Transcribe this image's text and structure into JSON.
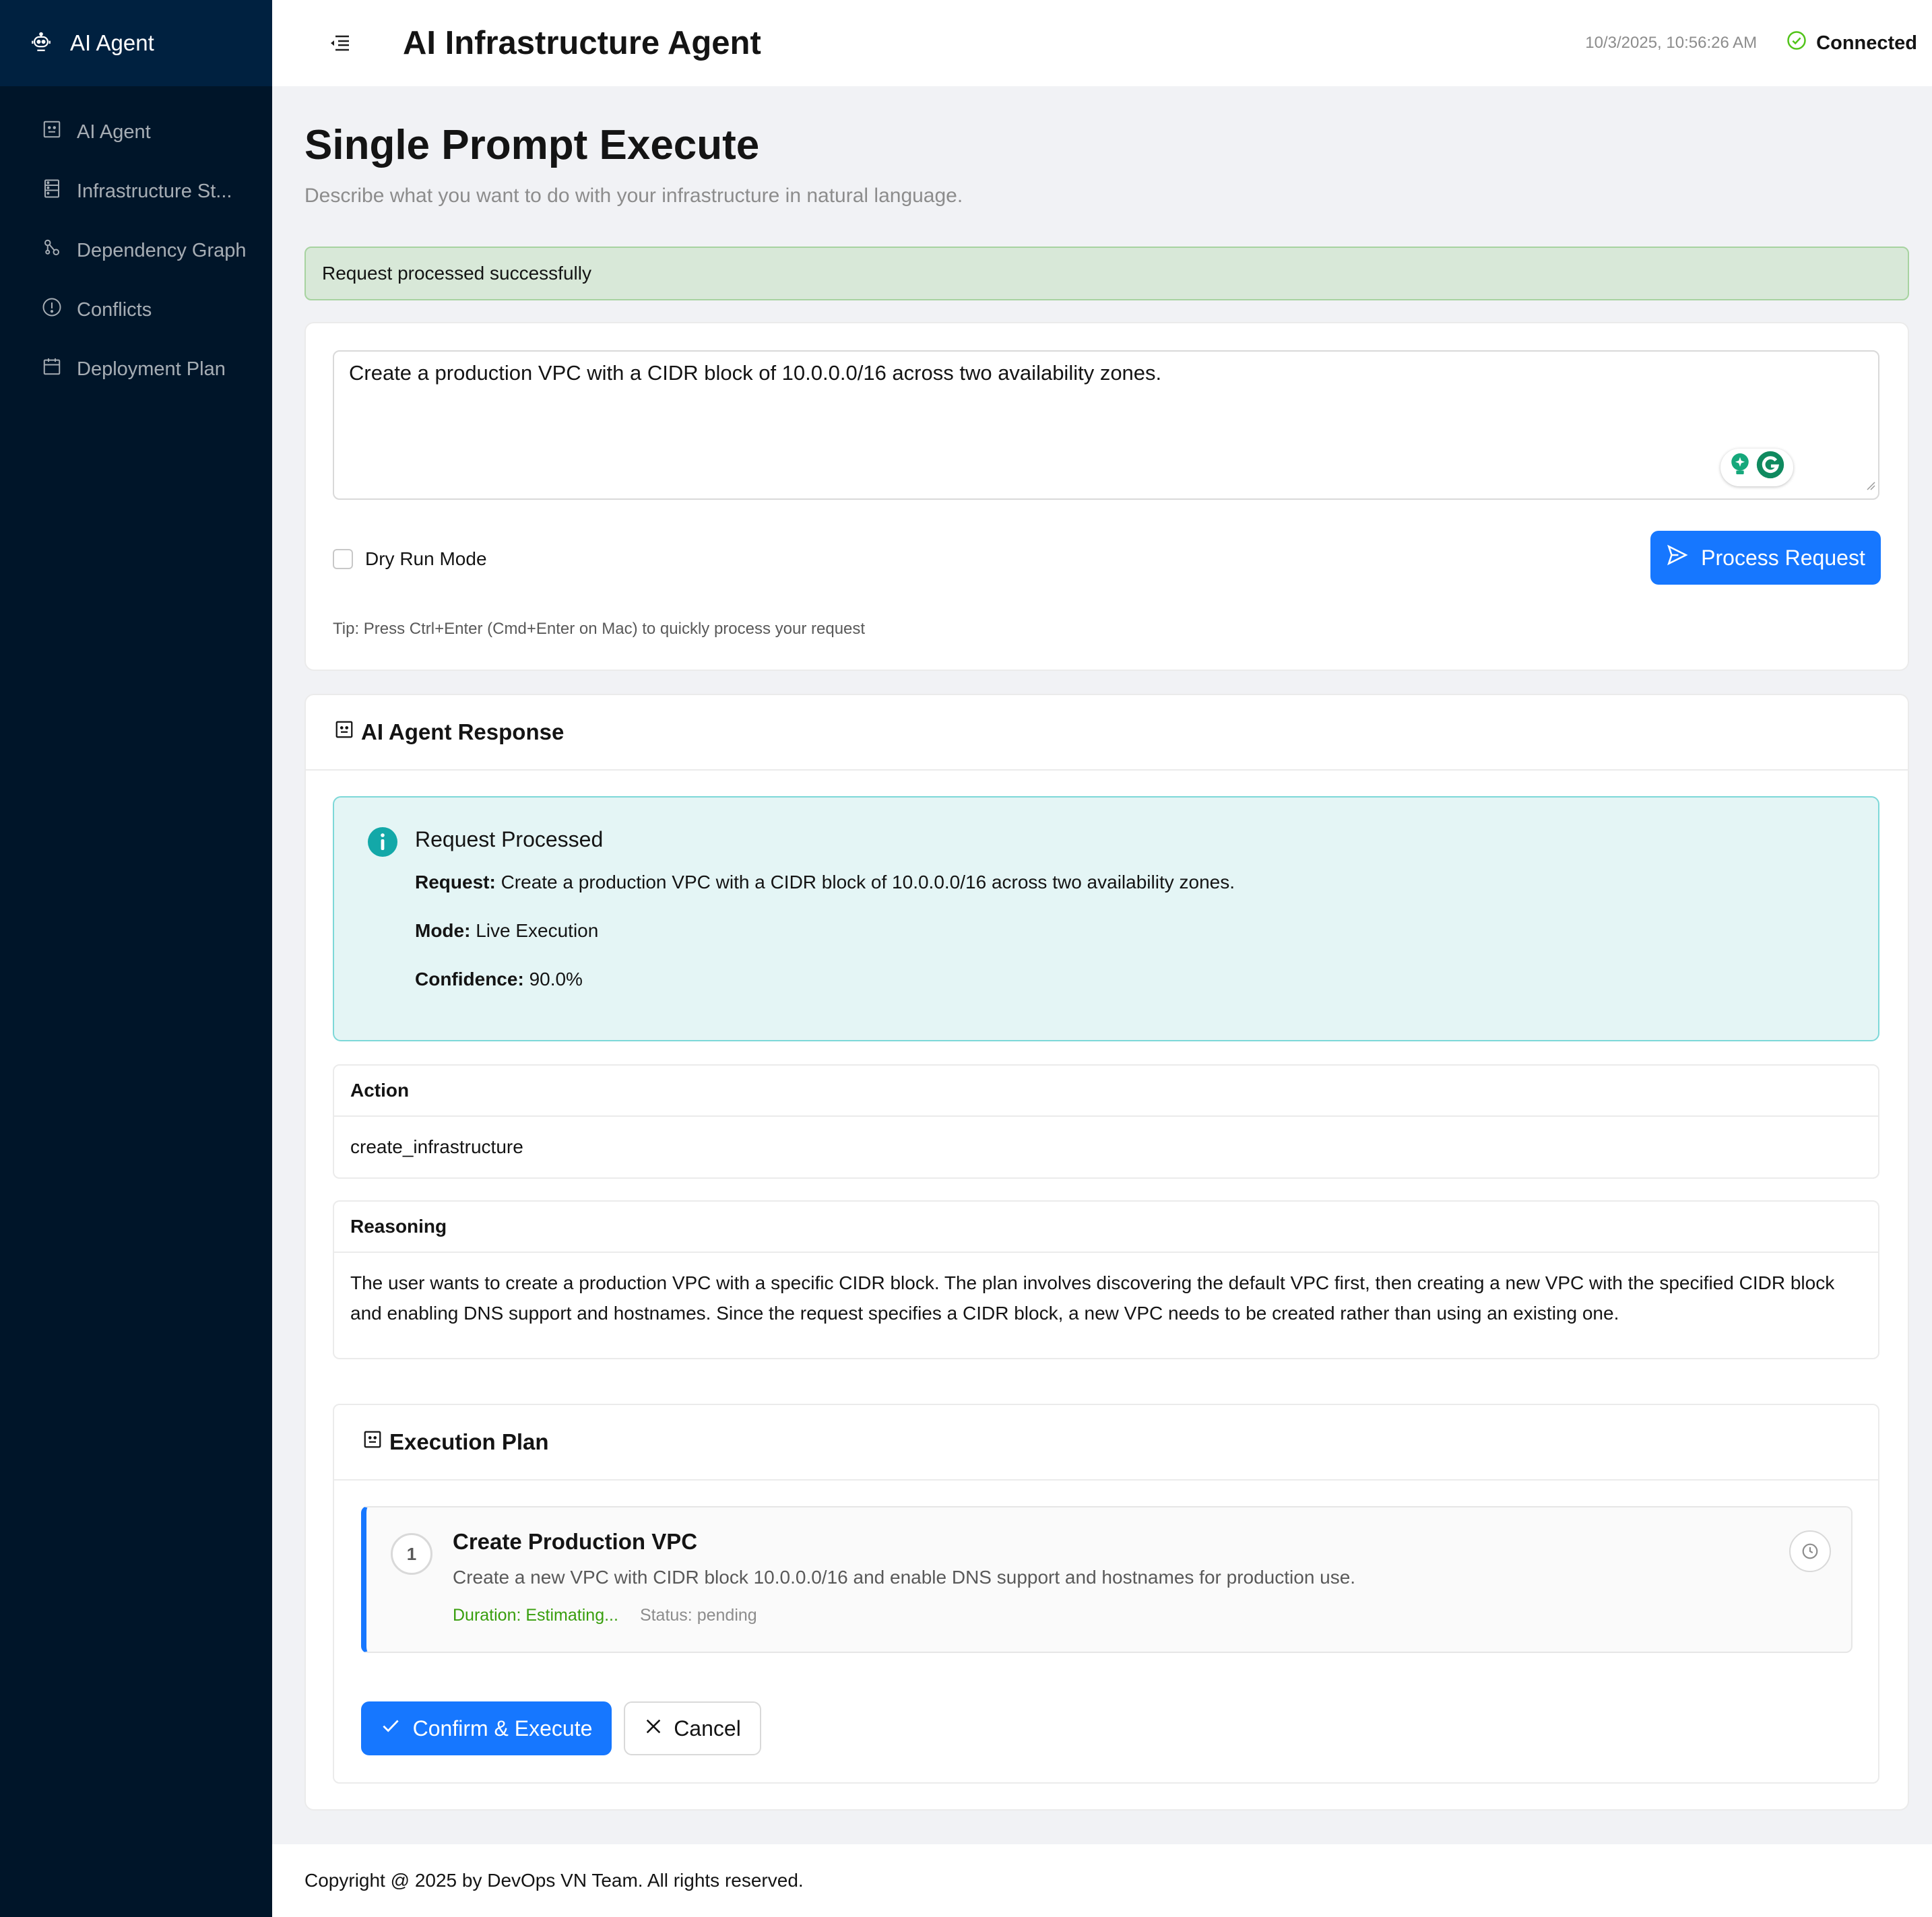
{
  "sidebar": {
    "brand": "AI Agent",
    "items": [
      {
        "label": "AI Agent",
        "icon": "robot-icon"
      },
      {
        "label": "Infrastructure St...",
        "icon": "database-icon"
      },
      {
        "label": "Dependency Graph",
        "icon": "graph-icon"
      },
      {
        "label": "Conflicts",
        "icon": "exclamation-circle-icon"
      },
      {
        "label": "Deployment Plan",
        "icon": "calendar-icon"
      }
    ]
  },
  "header": {
    "title": "AI Infrastructure Agent",
    "timestamp": "10/3/2025, 10:56:26 AM",
    "connection": "Connected"
  },
  "page": {
    "title": "Single Prompt Execute",
    "subtitle": "Describe what you want to do with your infrastructure in natural language.",
    "alert": "Request processed successfully"
  },
  "prompt": {
    "value": "Create a production VPC with a CIDR block of 10.0.0.0/16 across two availability zones.",
    "dry_run_label": "Dry Run Mode",
    "process_label": "Process Request",
    "tip": "Tip: Press Ctrl+Enter (Cmd+Enter on Mac) to quickly process your request"
  },
  "response": {
    "title": "AI Agent Response",
    "info_title": "Request Processed",
    "request_label": "Request:",
    "request_value": "Create a production VPC with a CIDR block of 10.0.0.0/16 across two availability zones.",
    "mode_label": "Mode:",
    "mode_value": "Live Execution",
    "confidence_label": "Confidence:",
    "confidence_value": "90.0%",
    "action_label": "Action",
    "action_value": "create_infrastructure",
    "reasoning_label": "Reasoning",
    "reasoning_value": "The user wants to create a production VPC with a specific CIDR block. The plan involves discovering the default VPC first, then creating a new VPC with the specified CIDR block and enabling DNS support and hostnames. Since the request specifies a CIDR block, a new VPC needs to be created rather than using an existing one."
  },
  "plan": {
    "title": "Execution Plan",
    "steps": [
      {
        "number": "1",
        "title": "Create Production VPC",
        "description": "Create a new VPC with CIDR block 10.0.0.0/16 and enable DNS support and hostnames for production use.",
        "duration": "Duration: Estimating...",
        "status": "Status: pending"
      }
    ],
    "confirm_label": "Confirm & Execute",
    "cancel_label": "Cancel"
  },
  "footer": {
    "copyright": "Copyright @ 2025 by DevOps VN Team. All rights reserved."
  },
  "colors": {
    "sidebar_bg": "#001529",
    "primary": "#1677ff",
    "success_bg": "#d8e8d8",
    "info_bg": "#e4f5f5",
    "connected": "#52c41a",
    "duration_green": "#389e0d"
  }
}
